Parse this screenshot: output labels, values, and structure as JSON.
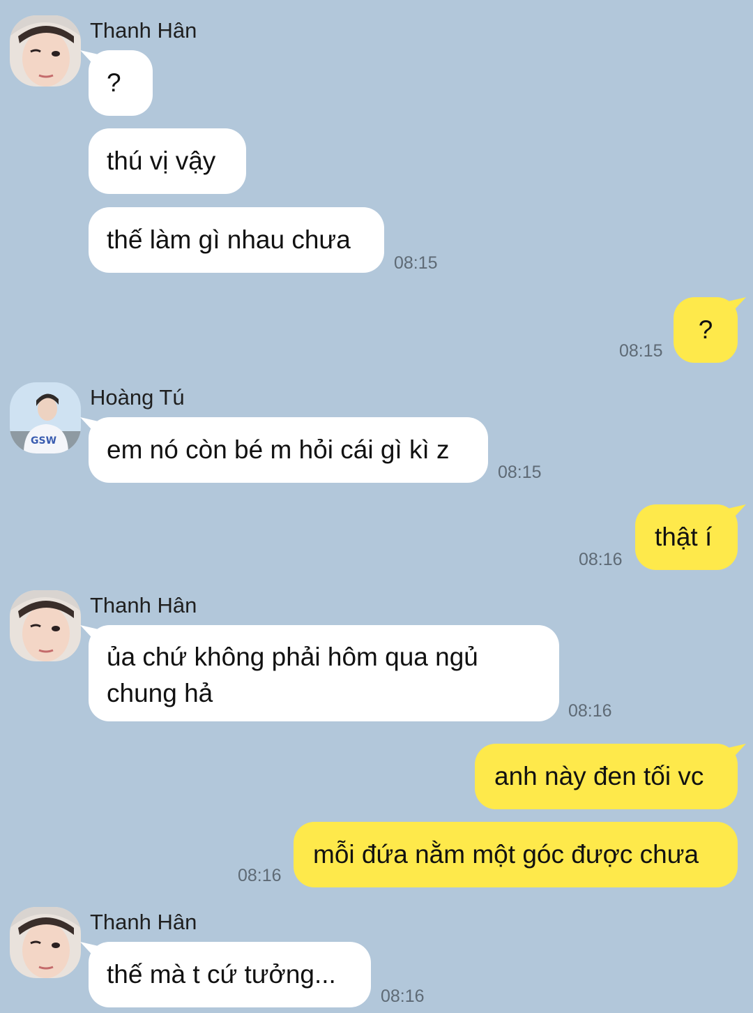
{
  "colors": {
    "background": "#b2c7da",
    "incoming": "#ffffff",
    "outgoing": "#fee94b"
  },
  "messages": {
    "m1": {
      "sender": "Thanh Hân",
      "text": "?"
    },
    "m2": {
      "text": "thú vị vậy"
    },
    "m3": {
      "text": "thế làm gì nhau chưa",
      "time": "08:15"
    },
    "m4": {
      "text": "?",
      "time": "08:15"
    },
    "m5": {
      "sender": "Hoàng Tú",
      "text": "em nó còn bé m hỏi cái gì kì z",
      "time": "08:15"
    },
    "m6": {
      "text": "thật í",
      "time": "08:16"
    },
    "m7": {
      "sender": "Thanh Hân",
      "text": "ủa chứ không phải hôm qua ngủ chung hả",
      "time": "08:16"
    },
    "m8": {
      "text": "anh này đen tối vc"
    },
    "m9": {
      "text": "mỗi đứa nằm một góc được chưa",
      "time": "08:16"
    },
    "m10": {
      "sender": "Thanh Hân",
      "text": "thế mà t cứ tưởng...",
      "time": "08:16"
    }
  }
}
